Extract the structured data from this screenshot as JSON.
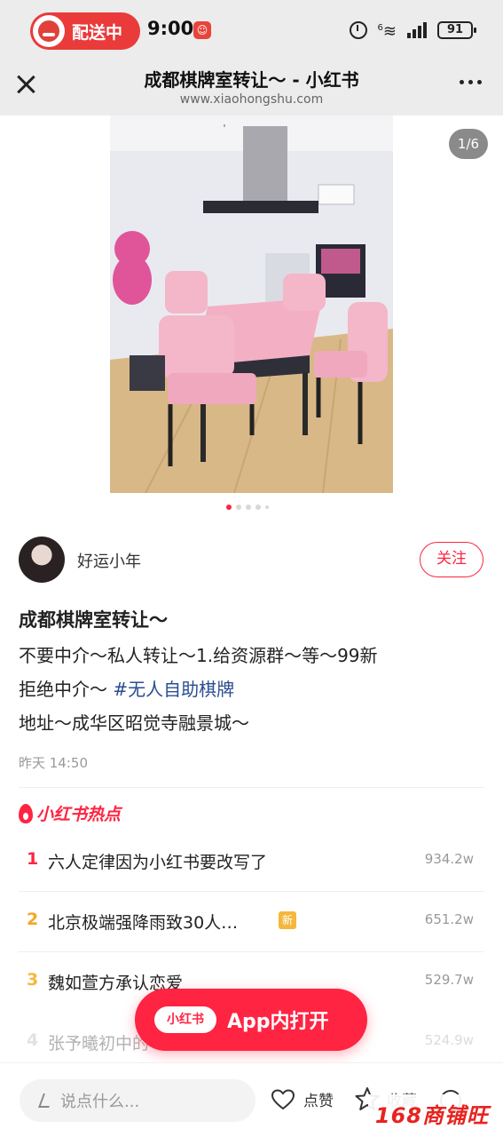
{
  "status_bar": {
    "delivery_label": "配送中",
    "time": "9:00",
    "battery": "91",
    "network": "6"
  },
  "title_bar": {
    "title": "成都棋牌室转让～ - 小红书",
    "url": "www.xiaohongshu.com"
  },
  "gallery": {
    "counter": "1/6",
    "total": 6,
    "current": 1
  },
  "author": {
    "name": "好运小年",
    "follow_label": "关注"
  },
  "post": {
    "title": "成都棋牌室转让～",
    "line1": "不要中介～私人转让～1.给资源群～等～99新",
    "line2_prefix": "拒绝中介～",
    "line2_hashtag": "#无人自助棋牌",
    "line3": "地址～成华区昭觉寺融景城～",
    "date": "昨天 14:50"
  },
  "hot": {
    "title": "小红书热点",
    "items": [
      {
        "rank": "1",
        "text": "六人定律因为小红书要改写了",
        "count": "934.2w",
        "rank_color": "#ff2442"
      },
      {
        "rank": "2",
        "text": "北京极端强降雨致30人…",
        "count": "651.2w",
        "rank_color": "#f5a623",
        "badge": "新"
      },
      {
        "rank": "3",
        "text": "魏如萱方承认恋爱",
        "count": "529.7w",
        "rank_color": "#f5b83d"
      },
      {
        "rank": "4",
        "text": "张予曦初中的",
        "count": "524.9w",
        "rank_color": "#aaaaaa"
      }
    ]
  },
  "open_app": {
    "logo": "小红书",
    "label": "App内打开"
  },
  "bottom_bar": {
    "comment_placeholder": "说点什么...",
    "like_label": "点赞",
    "collect_label": "收藏"
  },
  "watermark": "168商铺旺",
  "colors": {
    "brand_red": "#ff2442",
    "hashtag_blue": "#2a4d8f"
  }
}
